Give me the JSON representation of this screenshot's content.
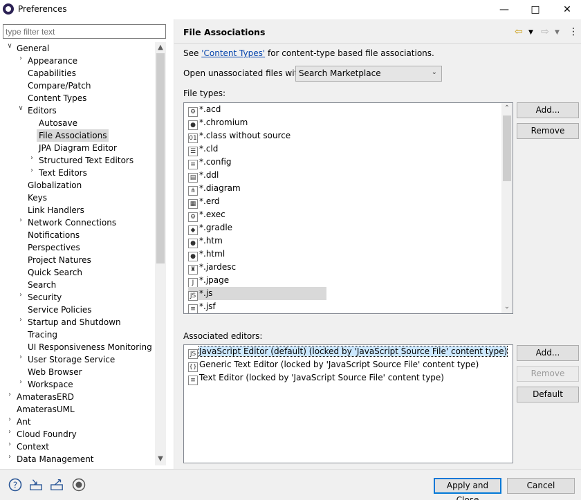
{
  "window": {
    "title": "Preferences"
  },
  "filter": {
    "placeholder": "type filter text"
  },
  "tree": [
    {
      "label": "General",
      "arrow": "v"
    },
    {
      "label": "Appearance",
      "arrow": ">"
    },
    {
      "label": "Capabilities",
      "arrow": ""
    },
    {
      "label": "Compare/Patch",
      "arrow": ""
    },
    {
      "label": "Content Types",
      "arrow": ""
    },
    {
      "label": "Editors",
      "arrow": "v"
    },
    {
      "label": "Autosave",
      "arrow": ""
    },
    {
      "label": "File Associations",
      "arrow": ""
    },
    {
      "label": "JPA Diagram Editor",
      "arrow": ""
    },
    {
      "label": "Structured Text Editors",
      "arrow": ">"
    },
    {
      "label": "Text Editors",
      "arrow": ">"
    },
    {
      "label": "Globalization",
      "arrow": ""
    },
    {
      "label": "Keys",
      "arrow": ""
    },
    {
      "label": "Link Handlers",
      "arrow": ""
    },
    {
      "label": "Network Connections",
      "arrow": ">"
    },
    {
      "label": "Notifications",
      "arrow": ""
    },
    {
      "label": "Perspectives",
      "arrow": ""
    },
    {
      "label": "Project Natures",
      "arrow": ""
    },
    {
      "label": "Quick Search",
      "arrow": ""
    },
    {
      "label": "Search",
      "arrow": ""
    },
    {
      "label": "Security",
      "arrow": ">"
    },
    {
      "label": "Service Policies",
      "arrow": ""
    },
    {
      "label": "Startup and Shutdown",
      "arrow": ">"
    },
    {
      "label": "Tracing",
      "arrow": ""
    },
    {
      "label": "UI Responsiveness Monitoring",
      "arrow": ""
    },
    {
      "label": "User Storage Service",
      "arrow": ">"
    },
    {
      "label": "Web Browser",
      "arrow": ""
    },
    {
      "label": "Workspace",
      "arrow": ">"
    },
    {
      "label": "AmaterasERD",
      "arrow": ">"
    },
    {
      "label": "AmaterasUML",
      "arrow": ""
    },
    {
      "label": "Ant",
      "arrow": ">"
    },
    {
      "label": "Cloud Foundry",
      "arrow": ">"
    },
    {
      "label": "Context",
      "arrow": ">"
    },
    {
      "label": "Data Management",
      "arrow": ">"
    }
  ],
  "page": {
    "title": "File Associations",
    "see_prefix": "See ",
    "see_link": "'Content Types'",
    "see_suffix": " for content-type based file associations.",
    "open_unassociated_label": "Open unassociated files with:",
    "open_unassociated_value": "Search Marketplace",
    "file_types_label": "File types:",
    "file_types": [
      {
        "name": "*.acd",
        "icon": "acd-icon",
        "glyph": "⚙"
      },
      {
        "name": "*.chromium",
        "icon": "chromium-icon",
        "glyph": "●"
      },
      {
        "name": "*.class without source",
        "icon": "class-file-icon",
        "glyph": "01"
      },
      {
        "name": "*.cld",
        "icon": "cld-icon",
        "glyph": "☰"
      },
      {
        "name": "*.config",
        "icon": "text-file-icon",
        "glyph": "≡"
      },
      {
        "name": "*.ddl",
        "icon": "ddl-icon",
        "glyph": "▤"
      },
      {
        "name": "*.diagram",
        "icon": "diagram-icon",
        "glyph": "⋔"
      },
      {
        "name": "*.erd",
        "icon": "erd-table-icon",
        "glyph": "▦"
      },
      {
        "name": "*.exec",
        "icon": "gears-icon",
        "glyph": "⚙"
      },
      {
        "name": "*.gradle",
        "icon": "gradle-icon",
        "glyph": "◆"
      },
      {
        "name": "*.htm",
        "icon": "globe-icon",
        "glyph": "●"
      },
      {
        "name": "*.html",
        "icon": "globe-icon",
        "glyph": "●"
      },
      {
        "name": "*.jardesc",
        "icon": "jardesc-icon",
        "glyph": "♜"
      },
      {
        "name": "*.jpage",
        "icon": "jpage-icon",
        "glyph": "J"
      },
      {
        "name": "*.js",
        "icon": "js-file-icon",
        "glyph": "JS"
      },
      {
        "name": "*.jsf",
        "icon": "text-file-icon",
        "glyph": "≡"
      }
    ],
    "file_types_add": "Add...",
    "file_types_remove": "Remove",
    "associated_editors_label": "Associated editors:",
    "associated_editors": [
      {
        "label": "JavaScript Editor (default) (locked by 'JavaScript Source File' content type)",
        "icon": "js-editor-icon",
        "glyph": "JS"
      },
      {
        "label": "Generic Text Editor (locked by 'JavaScript Source File' content type)",
        "icon": "generic-editor-icon",
        "glyph": "{}"
      },
      {
        "label": "Text Editor (locked by 'JavaScript Source File' content type)",
        "icon": "text-editor-icon",
        "glyph": "≡"
      }
    ],
    "editors_add": "Add...",
    "editors_remove": "Remove",
    "editors_default": "Default"
  },
  "footer": {
    "apply_close": "Apply and Close",
    "cancel": "Cancel"
  },
  "colors": {
    "selection": "#d9d9d9",
    "focus": "#0078d7",
    "link": "#0645ad"
  }
}
